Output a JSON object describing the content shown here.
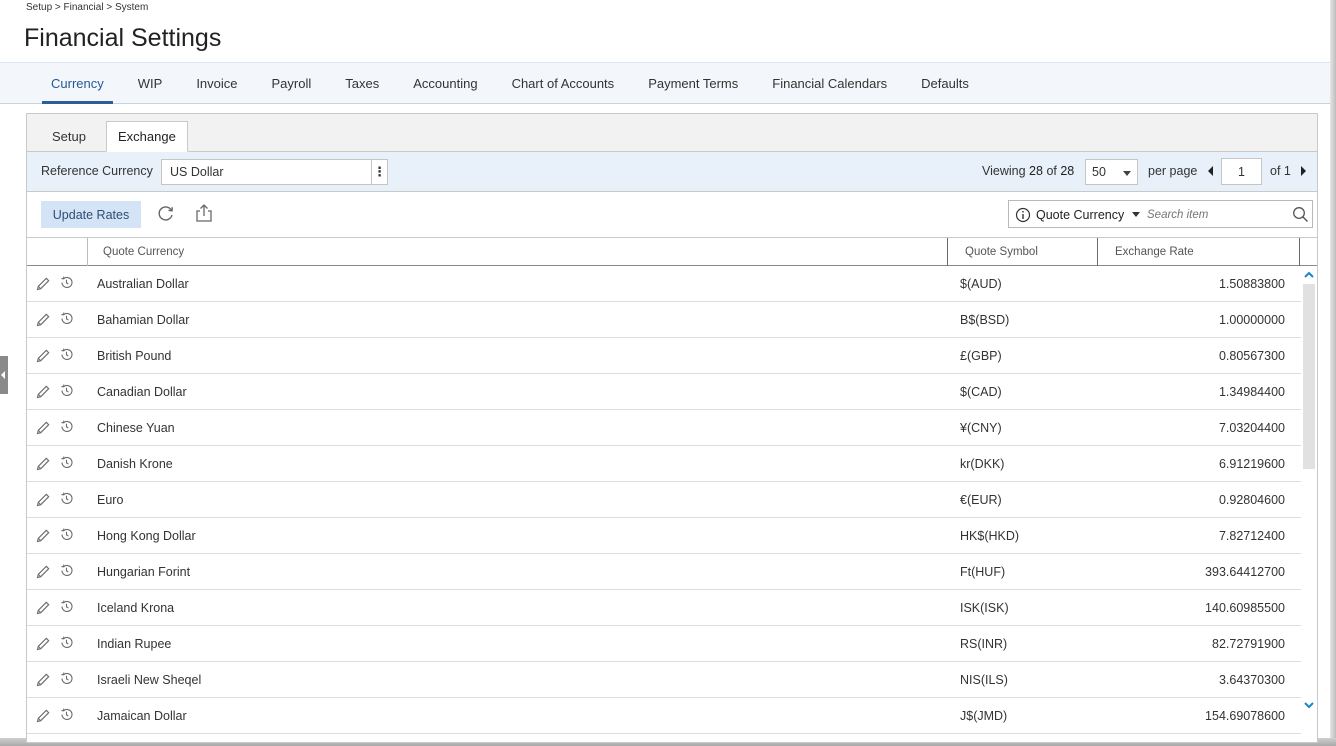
{
  "breadcrumb": "Setup > Financial > System",
  "page_title": "Financial Settings",
  "main_tabs": [
    {
      "label": "Currency",
      "active": true
    },
    {
      "label": "WIP"
    },
    {
      "label": "Invoice"
    },
    {
      "label": "Payroll"
    },
    {
      "label": "Taxes"
    },
    {
      "label": "Accounting"
    },
    {
      "label": "Chart of Accounts"
    },
    {
      "label": "Payment Terms"
    },
    {
      "label": "Financial Calendars"
    },
    {
      "label": "Defaults"
    }
  ],
  "sub_tabs": [
    {
      "label": "Setup"
    },
    {
      "label": "Exchange",
      "active": true
    }
  ],
  "reference": {
    "label": "Reference Currency",
    "value": "US Dollar",
    "menu_glyph": "⋮"
  },
  "pagination": {
    "viewing_label": "Viewing",
    "shown": "28",
    "of_label": "of",
    "total": "28",
    "per_page_value": "50",
    "per_page_label": "per page",
    "page": "1",
    "of_pages": "of 1"
  },
  "toolbar": {
    "update_rates_label": "Update Rates",
    "refresh_icon": "refresh-icon",
    "export_icon": "export-icon"
  },
  "search": {
    "field_label": "Quote Currency",
    "placeholder": "Search item"
  },
  "columns": {
    "quote_currency": "Quote Currency",
    "quote_symbol": "Quote Symbol",
    "exchange_rate": "Exchange Rate"
  },
  "rows": [
    {
      "currency": "Australian Dollar",
      "symbol": "$(AUD)",
      "rate": "1.50883800"
    },
    {
      "currency": "Bahamian Dollar",
      "symbol": "B$(BSD)",
      "rate": "1.00000000"
    },
    {
      "currency": "British Pound",
      "symbol": "£(GBP)",
      "rate": "0.80567300"
    },
    {
      "currency": "Canadian Dollar",
      "symbol": "$(CAD)",
      "rate": "1.34984400"
    },
    {
      "currency": "Chinese Yuan",
      "symbol": "¥(CNY)",
      "rate": "7.03204400"
    },
    {
      "currency": "Danish Krone",
      "symbol": "kr(DKK)",
      "rate": "6.91219600"
    },
    {
      "currency": "Euro",
      "symbol": "€(EUR)",
      "rate": "0.92804600"
    },
    {
      "currency": "Hong Kong Dollar",
      "symbol": "HK$(HKD)",
      "rate": "7.82712400"
    },
    {
      "currency": "Hungarian Forint",
      "symbol": "Ft(HUF)",
      "rate": "393.64412700"
    },
    {
      "currency": "Iceland Krona",
      "symbol": "ISK(ISK)",
      "rate": "140.60985500"
    },
    {
      "currency": "Indian Rupee",
      "symbol": "RS(INR)",
      "rate": "82.72791900"
    },
    {
      "currency": "Israeli New Sheqel",
      "symbol": "NIS(ILS)",
      "rate": "3.64370300"
    },
    {
      "currency": "Jamaican Dollar",
      "symbol": "J$(JMD)",
      "rate": "154.69078600"
    }
  ],
  "colors": {
    "accent": "#2a5f99",
    "tab_bar_bg": "#f3f7fb",
    "ref_bar_bg": "#e8f1f9",
    "update_btn_bg": "#d4e4f6",
    "icon_color": "#6a6a6a",
    "scroll_arrow": "#1a86c8"
  }
}
